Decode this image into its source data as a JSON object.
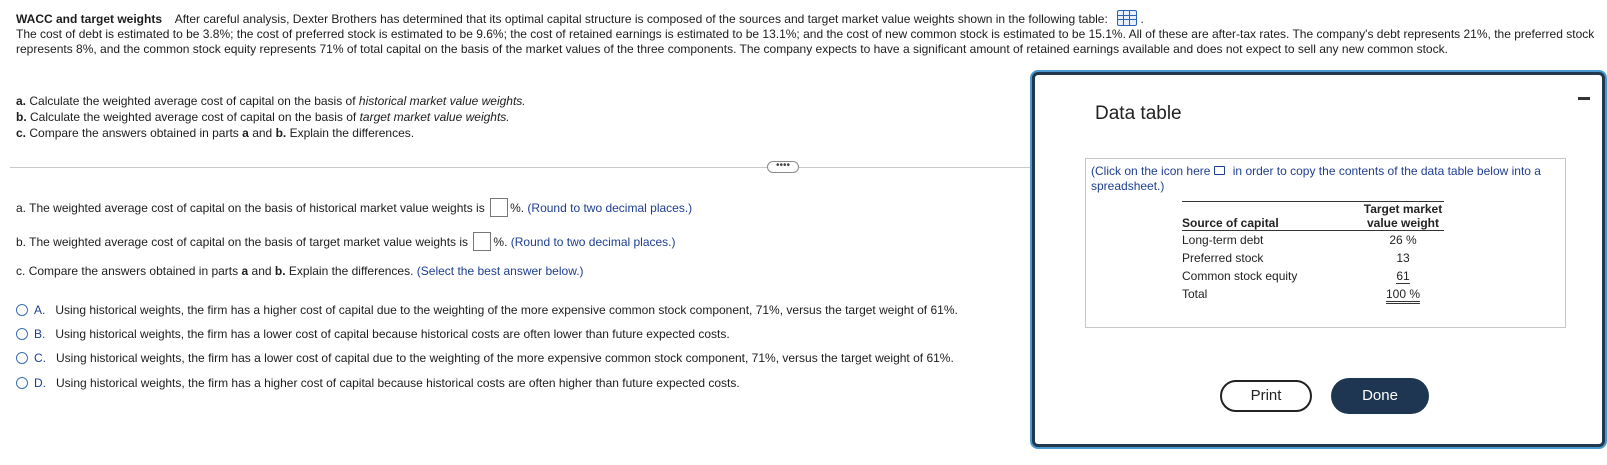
{
  "problem": {
    "title": "WACC and target weights",
    "intro": "After careful analysis, Dexter Brothers has determined that its optimal capital structure is composed of the sources and target market value weights shown in the following table:",
    "paragraph": "The cost of debt is estimated to be 3.8%; the cost of preferred stock is estimated to be 9.6%; the cost of retained earnings is estimated to be 13.1%; and the cost of new common stock is estimated to be 15.1%. All of these are after-tax rates.  The company's debt represents 21%, the preferred stock represents 8%, and the common stock equity represents 71% of total capital on the basis of the market values of the three components.  The company expects to have a significant amount of retained earnings available and does not expect to sell any new common stock."
  },
  "parts": {
    "a_prefix": "a.",
    "a_text": "Calculate the weighted average cost of capital on the basis of",
    "a_italic": "historical market value weights.",
    "b_prefix": "b.",
    "b_text": "Calculate the weighted average cost of capital on the basis of",
    "b_italic": "target market value weights.",
    "c_prefix": "c.",
    "c_text1": "Compare the answers obtained in parts",
    "c_a": "a",
    "c_and": "and",
    "c_b": "b.",
    "c_text2": "Explain the differences."
  },
  "more_label": "••••",
  "questions": {
    "a": {
      "prefix": "a.",
      "text": "The weighted average cost of capital on the basis of historical market value weights is",
      "suffix": "%.",
      "hint": "(Round to two decimal places.)"
    },
    "b": {
      "prefix": "b.",
      "text": "The weighted average cost of capital on the basis of target market value weights is",
      "suffix": "%.",
      "hint": "(Round to two decimal places.)"
    },
    "c": {
      "prefix": "c.",
      "text1": "Compare the answers obtained in parts",
      "a": "a",
      "and": "and",
      "b": "b.",
      "text2": "Explain the differences.",
      "hint": "(Select the best answer below.)"
    }
  },
  "options": [
    {
      "letter": "A.",
      "text": "Using historical weights, the firm has a higher cost of capital due to the weighting of the more expensive common stock component, 71%, versus the target weight of 61%."
    },
    {
      "letter": "B.",
      "text": "Using historical weights, the firm has a lower cost of capital because historical costs are often lower than future expected costs."
    },
    {
      "letter": "C.",
      "text": "Using historical weights, the firm has a lower cost of capital due to the weighting of the more expensive common stock component, 71%, versus the target weight of 61%."
    },
    {
      "letter": "D.",
      "text": "Using historical weights, the firm has a higher cost of capital because historical costs are often higher than future expected costs."
    }
  ],
  "modal": {
    "title": "Data table",
    "copy_note_1": "(Click on the icon",
    "copy_note_here": "here",
    "copy_note_2": "in order to copy the contents of the data table below into a spreadsheet.)",
    "table": {
      "col1_header": "Source of capital",
      "col2_header_1": "Target market",
      "col2_header_2": "value weight",
      "rows": [
        {
          "source": "Long-term debt",
          "weight": "26 %"
        },
        {
          "source": "Preferred stock",
          "weight": "13"
        },
        {
          "source": "Common stock equity",
          "weight": "61"
        }
      ],
      "total_label": "Total",
      "total_value": "100 %"
    },
    "print_label": "Print",
    "done_label": "Done"
  },
  "colors": {
    "accent": "#1d3e8f",
    "done_button": "#1e3651",
    "modal_border": "#21384f"
  }
}
